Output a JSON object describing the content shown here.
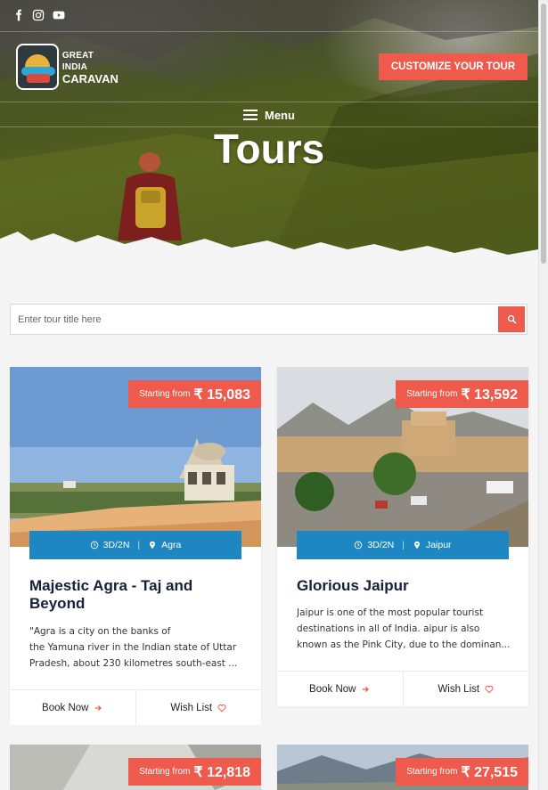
{
  "header": {
    "social": [
      "facebook-icon",
      "instagram-icon",
      "youtube-icon"
    ],
    "logo": {
      "line1": "GREAT INDIA",
      "line2": "CARAVAN"
    },
    "cta_label": "CUSTOMIZE YOUR TOUR",
    "menu_label": "Menu",
    "page_title": "Tours"
  },
  "search": {
    "placeholder": "Enter tour title here"
  },
  "colors": {
    "accent": "#ee5a4b",
    "meta_bar": "#1e86c0",
    "title": "#15213a"
  },
  "tours": [
    {
      "price_label": "Starting from",
      "price": "₹ 15,083",
      "duration": "3D/2N",
      "location": "Agra",
      "title": "Majestic Agra - Taj and Beyond",
      "desc_l1": "\"Agra is a city on the banks of",
      "desc_l2": "the Yamuna river in the Indian state of Uttar",
      "desc_l3": "Pradesh, about 230 kilometres south-east ...",
      "book": "Book Now",
      "wish": "Wish List"
    },
    {
      "price_label": "Starting from",
      "price": "₹ 13,592",
      "duration": "3D/2N",
      "location": "Jaipur",
      "title": "Glorious Jaipur",
      "desc_l1": "Jaipur is one of the most popular tourist",
      "desc_l2": "destinations in all of India. aipur is also",
      "desc_l3": "known as the Pink City, due to the dominan...",
      "book": "Book Now",
      "wish": "Wish List"
    },
    {
      "price_label": "Starting from",
      "price": "₹ 12,818"
    },
    {
      "price_label": "Starting from",
      "price": "₹ 27,515"
    }
  ]
}
